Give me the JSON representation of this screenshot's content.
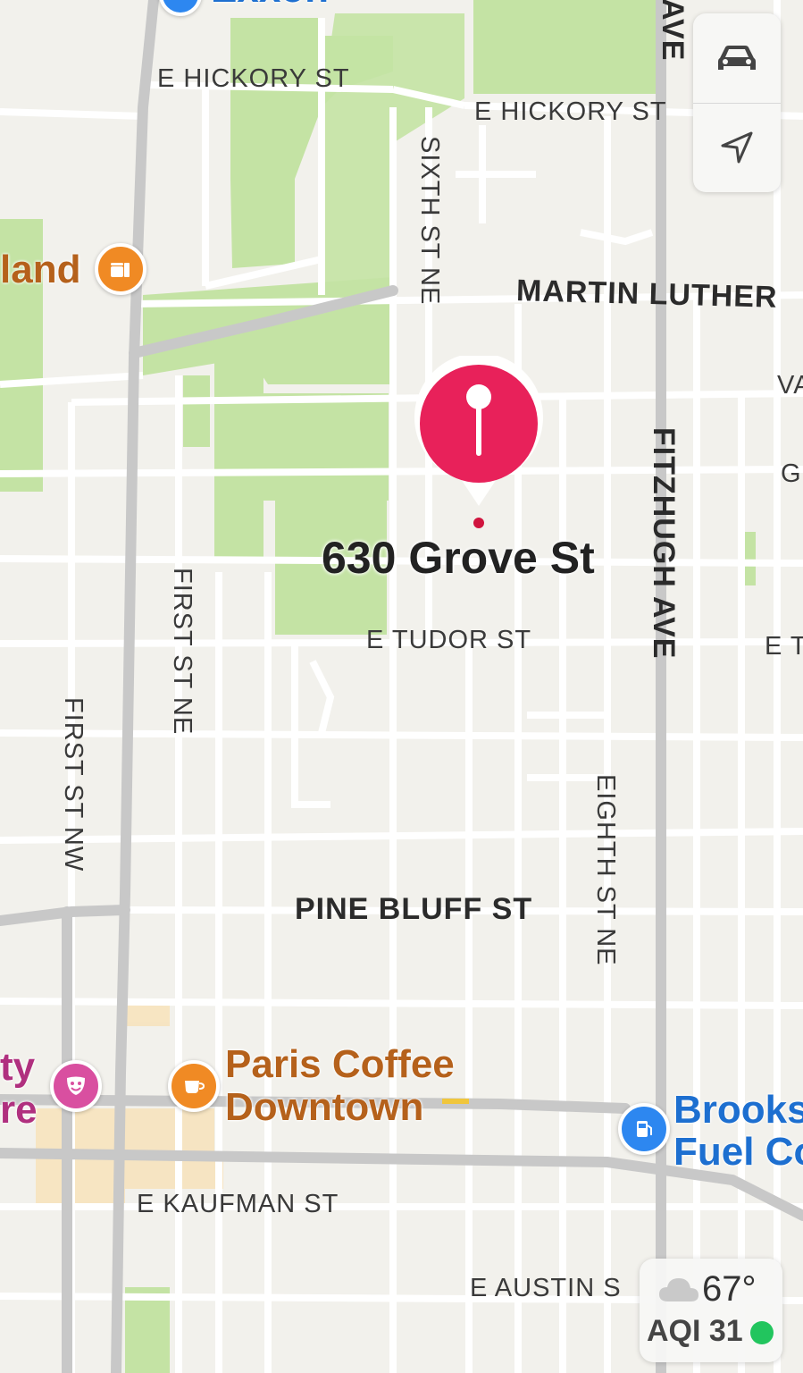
{
  "map": {
    "pin_address": "630 Grove St",
    "colors": {
      "pin": "#e8215a",
      "park": "#c4e3a4",
      "road_major": "#c8c8c8",
      "road_minor": "#ffffff",
      "background": "#f2f1ec",
      "downtown": "#f7e2b8"
    }
  },
  "streets": {
    "e_hickory_left": "E HICKORY ST",
    "e_hickory_right": "E HICKORY ST",
    "sixth_st_ne": "SIXTH ST NE",
    "mlk": "MARTIN LUTHER",
    "va": "VA",
    "g": "G",
    "fitzhugh": "FITZHUGH AVE",
    "ave_top": "AVE",
    "e_tudor": "E TUDOR ST",
    "e_t": "E T",
    "first_st_ne": "FIRST ST NE",
    "first_st_nw": "FIRST ST NW",
    "pine_bluff": "PINE BLUFF ST",
    "eighth_st_ne": "EIGHTH ST NE",
    "e_kaufman": "E KAUFMAN ST",
    "e_austin": "E AUSTIN S",
    "exxon": "Exxon"
  },
  "pois": {
    "land": {
      "label": "land",
      "icon": "restaurant-icon",
      "color": "#f08a24"
    },
    "theatre": {
      "label_line1": "ty",
      "label_line2": "re",
      "icon": "theater-masks-icon",
      "color": "#d94fa0"
    },
    "paris_coffee": {
      "label_line1": "Paris Coffee",
      "label_line2": "Downtown",
      "icon": "coffee-cup-icon",
      "color": "#f08a24",
      "text_color": "#b5611b"
    },
    "brooks_fuel": {
      "label_line1": "Brooks",
      "label_line2": "Fuel Co",
      "icon": "fuel-pump-icon",
      "color": "#2d87f0",
      "text_color": "#1d6fd0"
    }
  },
  "controls": {
    "drive_mode_icon": "car-icon",
    "location_icon": "location-arrow-icon"
  },
  "weather": {
    "icon": "cloud-icon",
    "temperature": "67°",
    "aqi": "AQI 31",
    "aqi_status_color": "#22c55e"
  }
}
